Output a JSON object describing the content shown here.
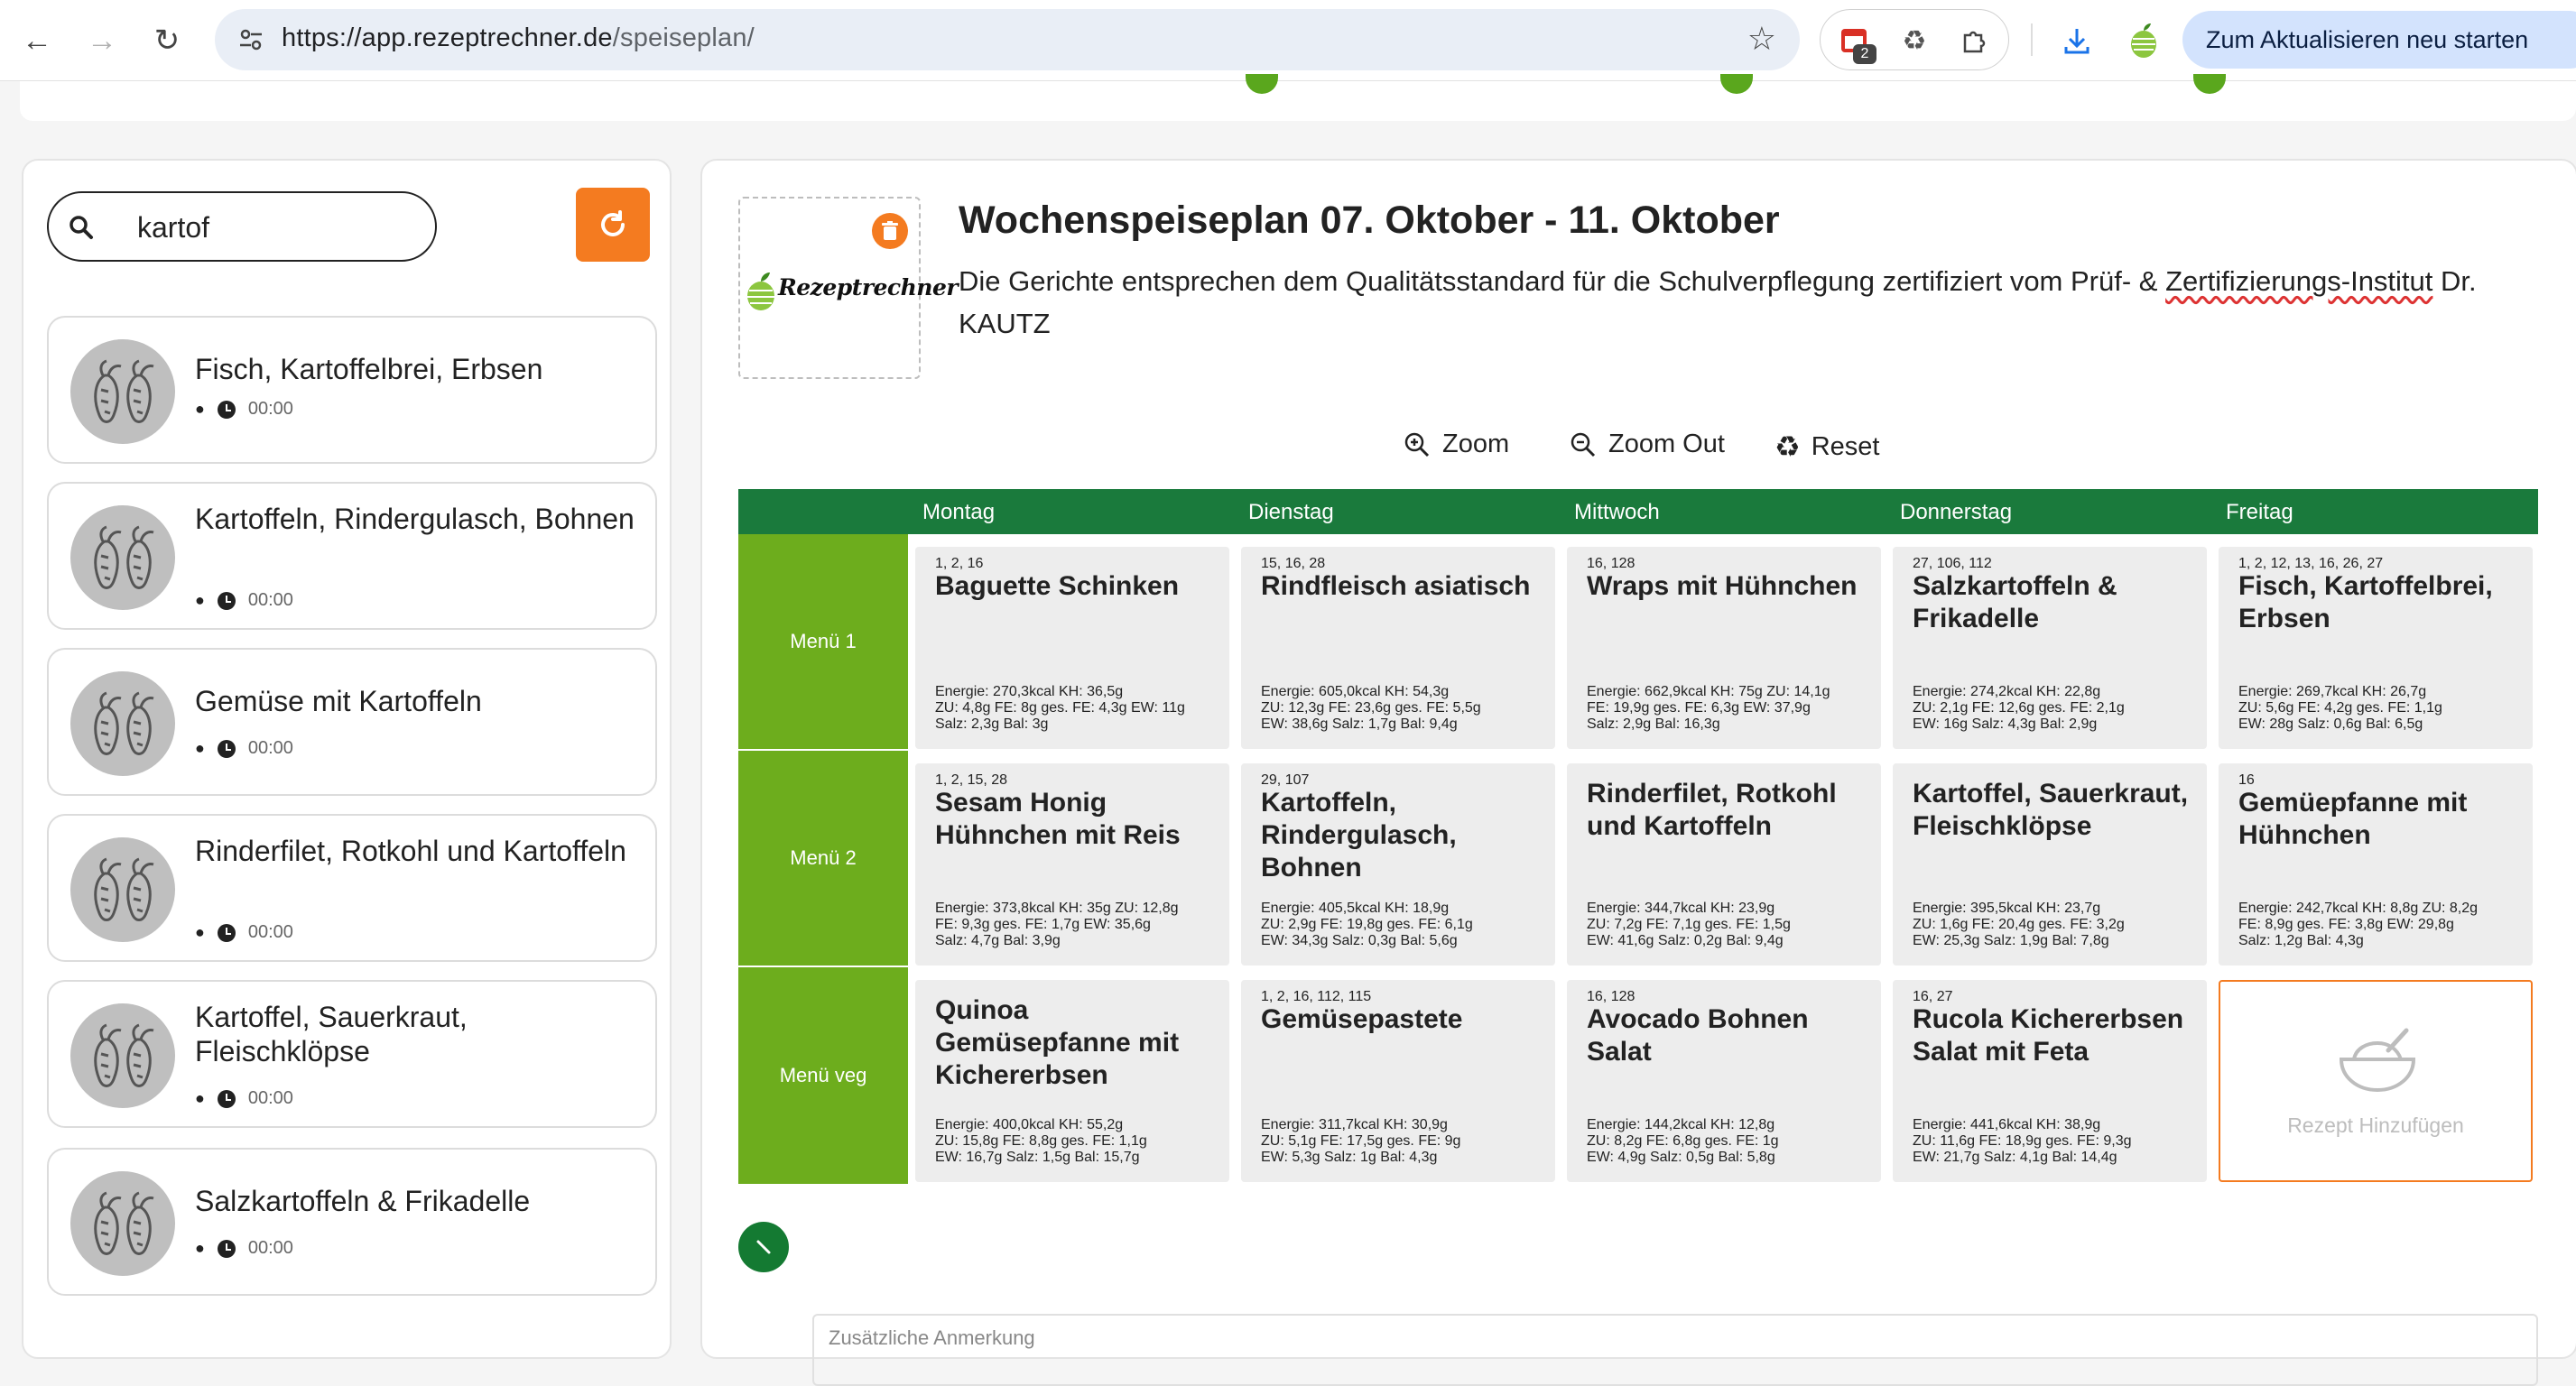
{
  "browser": {
    "url_host": "https://app.rezeptrechner.de",
    "url_path": "/speiseplan/",
    "ext_badge": "2",
    "update_label": "Zum Aktualisieren neu starten"
  },
  "sidebar": {
    "search_value": "kartof",
    "recipes": [
      {
        "title": "Fisch, Kartoffelbrei, Erbsen",
        "time": "00:00"
      },
      {
        "title": "Kartoffeln, Rindergulasch, Bohnen",
        "time": "00:00"
      },
      {
        "title": "Gemüse mit Kartoffeln",
        "time": "00:00"
      },
      {
        "title": "Rinderfilet, Rotkohl und Kartoffeln",
        "time": "00:00"
      },
      {
        "title": "Kartoffel, Sauerkraut, Fleischklöpse",
        "time": "00:00"
      },
      {
        "title": "Salzkartoffeln & Frikadelle",
        "time": "00:00"
      }
    ]
  },
  "plan": {
    "logo_text": "Rezeptrechner",
    "title": "Wochenspeiseplan 07. Oktober - 11. Oktober",
    "subtitle_a": "Die Gerichte entsprechen dem Qualitätsstandard für die Schulverpflegung zertifiziert vom Prüf- & ",
    "subtitle_b": "Zertifizierungs-Institut",
    "subtitle_c": " Dr. KAUTZ",
    "zoom_in": "Zoom",
    "zoom_out": "Zoom Out",
    "reset": "Reset",
    "notes_placeholder": "Zusätzliche Anmerkung"
  },
  "grid": {
    "days": [
      "Montag",
      "Dienstag",
      "Mittwoch",
      "Donnerstag",
      "Freitag"
    ],
    "menus": [
      "Menü 1",
      "Menü 2",
      "Menü veg"
    ],
    "add_label": "Rezept Hinzufügen",
    "cells": [
      [
        {
          "codes": "1, 2, 16",
          "dish": "Baguette Schinken",
          "n1": "Energie: 270,3kcal  KH: 36,5g",
          "n2": "ZU: 4,8g  FE: 8g  ges. FE: 4,3g  EW: 11g",
          "n3": "Salz: 2,3g  Bal: 3g"
        },
        {
          "codes": "15, 16, 28",
          "dish": "Rindfleisch asiatisch",
          "n1": "Energie: 605,0kcal  KH: 54,3g",
          "n2": "ZU: 12,3g  FE: 23,6g  ges. FE: 5,5g",
          "n3": "EW: 38,6g  Salz: 1,7g  Bal: 9,4g"
        },
        {
          "codes": "16, 128",
          "dish": "Wraps mit Hühnchen",
          "n1": "Energie: 662,9kcal  KH: 75g  ZU: 14,1g",
          "n2": "FE: 19,9g  ges. FE: 6,3g  EW: 37,9g",
          "n3": "Salz: 2,9g  Bal: 16,3g"
        },
        {
          "codes": "27, 106, 112",
          "dish": "Salzkartoffeln & Frikadelle",
          "n1": "Energie: 274,2kcal  KH: 22,8g",
          "n2": "ZU: 2,1g  FE: 12,6g  ges. FE: 2,1g",
          "n3": "EW: 16g  Salz: 4,3g  Bal: 2,9g"
        },
        {
          "codes": "1, 2, 12, 13, 16, 26, 27",
          "dish": "Fisch, Kartoffelbrei, Erbsen",
          "n1": "Energie: 269,7kcal  KH: 26,7g",
          "n2": "ZU: 5,6g  FE: 4,2g  ges. FE: 1,1g",
          "n3": "EW: 28g  Salz: 0,6g  Bal: 6,5g"
        }
      ],
      [
        {
          "codes": "1, 2, 15, 28",
          "dish": "Sesam Honig Hühnchen mit Reis",
          "n1": "Energie: 373,8kcal  KH: 35g  ZU: 12,8g",
          "n2": "FE: 9,3g  ges. FE: 1,7g  EW: 35,6g",
          "n3": "Salz: 4,7g  Bal: 3,9g"
        },
        {
          "codes": "29, 107",
          "dish": "Kartoffeln, Rindergulasch, Bohnen",
          "n1": "Energie: 405,5kcal  KH: 18,9g",
          "n2": "ZU: 2,9g  FE: 19,8g  ges. FE: 6,1g",
          "n3": "EW: 34,3g  Salz: 0,3g  Bal: 5,6g"
        },
        {
          "codes": "",
          "dish": "Rinderfilet, Rotkohl und Kartoffeln",
          "n1": "Energie: 344,7kcal  KH: 23,9g",
          "n2": "ZU: 7,2g  FE: 7,1g  ges. FE: 1,5g",
          "n3": "EW: 41,6g  Salz: 0,2g  Bal: 9,4g"
        },
        {
          "codes": "",
          "dish": "Kartoffel, Sauerkraut, Fleischklöpse",
          "n1": "Energie: 395,5kcal  KH: 23,7g",
          "n2": "ZU: 1,6g  FE: 20,4g  ges. FE: 3,2g",
          "n3": "EW: 25,3g  Salz: 1,9g  Bal: 7,8g"
        },
        {
          "codes": "16",
          "dish": "Gemüepfanne mit Hühnchen",
          "n1": "Energie: 242,7kcal  KH: 8,8g  ZU: 8,2g",
          "n2": "FE: 8,9g  ges. FE: 3,8g  EW: 29,8g",
          "n3": "Salz: 1,2g  Bal: 4,3g"
        }
      ],
      [
        {
          "codes": "",
          "dish": "Quinoa Gemüsepfanne mit Kichererbsen",
          "n1": "Energie: 400,0kcal  KH: 55,2g",
          "n2": "ZU: 15,8g  FE: 8,8g  ges. FE: 1,1g",
          "n3": "EW: 16,7g  Salz: 1,5g  Bal: 15,7g"
        },
        {
          "codes": "1, 2, 16, 112, 115",
          "dish": "Gemüsepastete",
          "n1": "Energie: 311,7kcal  KH: 30,9g",
          "n2": "ZU: 5,1g  FE: 17,5g  ges. FE: 9g",
          "n3": "EW: 5,3g  Salz: 1g  Bal: 4,3g"
        },
        {
          "codes": "16, 128",
          "dish": "Avocado Bohnen Salat",
          "n1": "Energie: 144,2kcal  KH: 12,8g",
          "n2": "ZU: 8,2g  FE: 6,8g  ges. FE: 1g",
          "n3": "EW: 4,9g  Salz: 0,5g  Bal: 5,8g"
        },
        {
          "codes": "16, 27",
          "dish": "Rucola Kichererbsen Salat mit Feta",
          "n1": "Energie: 441,6kcal  KH: 38,9g",
          "n2": "ZU: 11,6g  FE: 18,9g  ges. FE: 9,3g",
          "n3": "EW: 21,7g  Salz: 4,1g  Bal: 14,4g"
        },
        null
      ]
    ]
  }
}
